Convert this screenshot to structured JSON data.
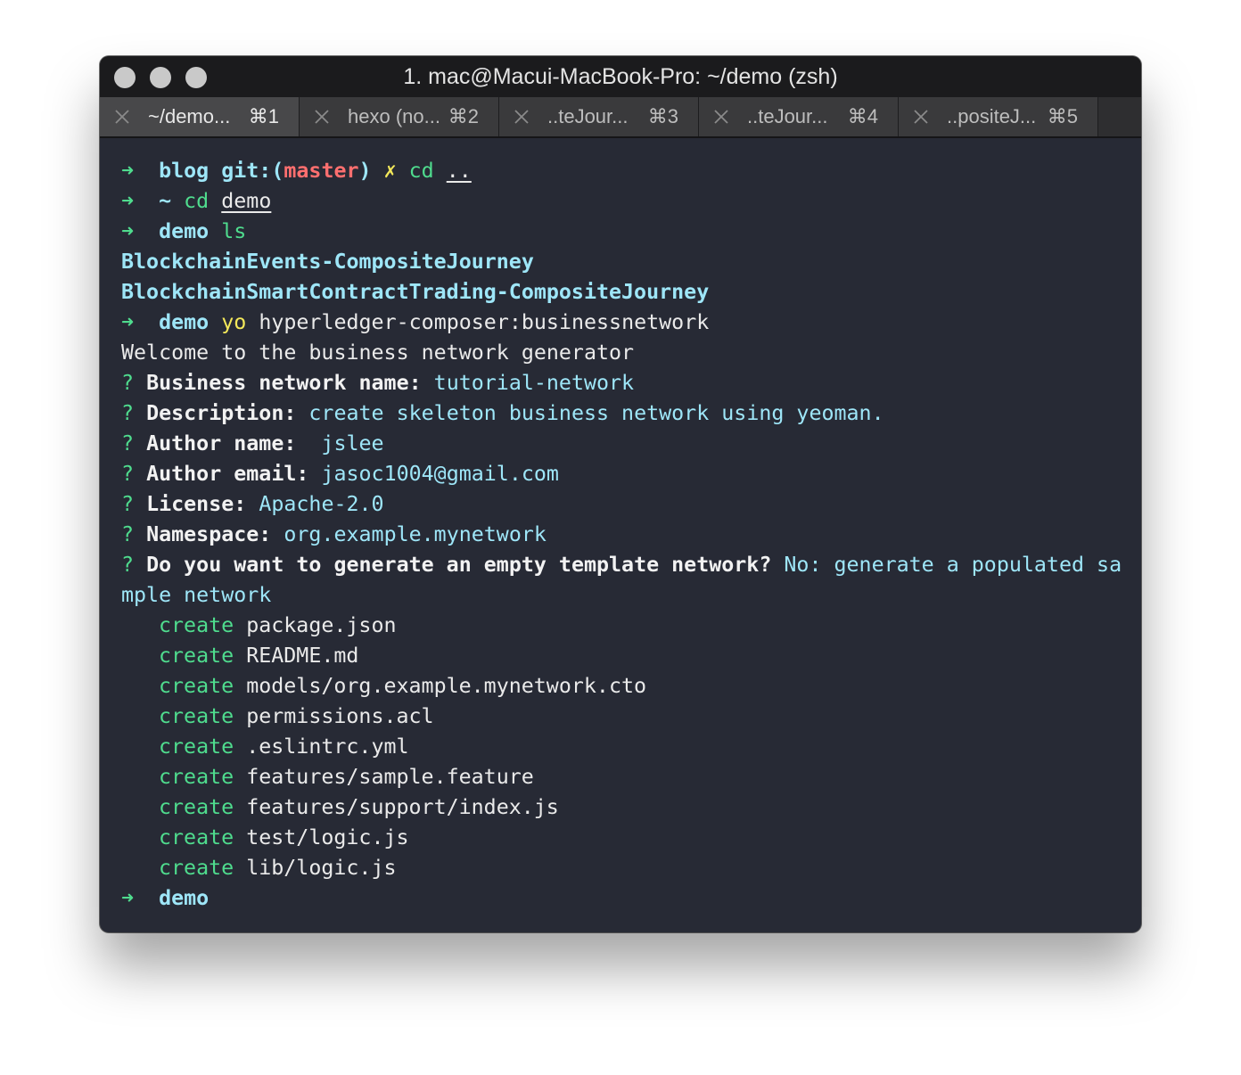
{
  "window": {
    "title": "1. mac@Macui-MacBook-Pro: ~/demo (zsh)"
  },
  "tabs": [
    {
      "label": "~/demo...",
      "shortcut": "⌘1"
    },
    {
      "label": "hexo (no...",
      "shortcut": "⌘2"
    },
    {
      "label": "..teJour...",
      "shortcut": "⌘3"
    },
    {
      "label": "..teJour...",
      "shortcut": "⌘4"
    },
    {
      "label": "..positeJ...",
      "shortcut": "⌘5"
    }
  ],
  "terminal": {
    "prompt_arrow": "➜",
    "line1": {
      "dir": "blog",
      "git_prefix": "git:(",
      "branch": "master",
      "git_suffix": ")",
      "dirty": "✗",
      "cmd": "cd",
      "arg": ".."
    },
    "line2": {
      "dir": "~",
      "cmd": "cd",
      "arg": "demo"
    },
    "line3": {
      "dir": "demo",
      "cmd": "ls"
    },
    "ls_output": [
      "BlockchainEvents-CompositeJourney",
      "BlockchainSmartContractTrading-CompositeJourney"
    ],
    "line6": {
      "dir": "demo",
      "cmd": "yo",
      "arg": "hyperledger-composer:businessnetwork"
    },
    "welcome": "Welcome to the business network generator",
    "qmark": "?",
    "questions": [
      {
        "label": "Business network name:",
        "answer": "tutorial-network"
      },
      {
        "label": "Description:",
        "answer": "create skeleton business network using yeoman."
      },
      {
        "label": "Author name:",
        "answer": " jslee"
      },
      {
        "label": "Author email:",
        "answer": "jasoc1004@gmail.com"
      },
      {
        "label": "License:",
        "answer": "Apache-2.0"
      },
      {
        "label": "Namespace:",
        "answer": "org.example.mynetwork"
      },
      {
        "label": "Do you want to generate an empty template network?",
        "answer": "No: generate a populated sa"
      }
    ],
    "wrap_line": "mple network",
    "create_word": "create",
    "created_files": [
      "package.json",
      "README.md",
      "models/org.example.mynetwork.cto",
      "permissions.acl",
      ".eslintrc.yml",
      "features/sample.feature",
      "features/support/index.js",
      "test/logic.js",
      "lib/logic.js"
    ],
    "final_dir": "demo"
  },
  "colors": {
    "background": "#272a35",
    "green": "#4fdc8e",
    "cyan": "#9ee6f8",
    "red": "#ff6f6f",
    "yellow": "#f3e85a"
  }
}
